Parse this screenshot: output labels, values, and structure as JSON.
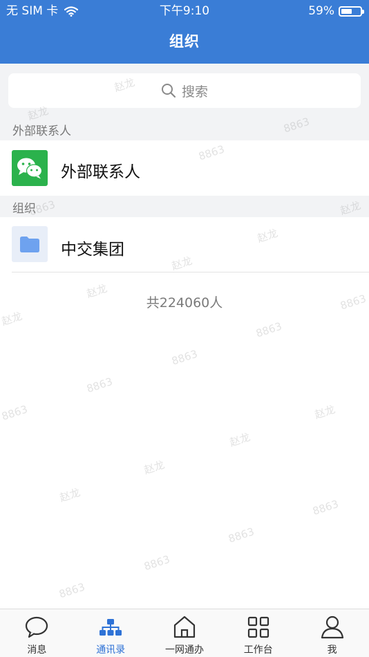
{
  "status_bar": {
    "carrier": "无 SIM 卡",
    "time": "下午9:10",
    "battery_text": "59%",
    "battery_level": 0.59
  },
  "nav": {
    "title": "组织"
  },
  "search": {
    "placeholder": "搜索"
  },
  "sections": {
    "external_header": "外部联系人",
    "org_header": "组织"
  },
  "rows": {
    "external": {
      "label": "外部联系人",
      "icon": "wechat-icon",
      "icon_color": "#2bb24c"
    },
    "org": {
      "label": "中交集团",
      "icon": "folder-icon",
      "icon_color": "#6ea2ef"
    }
  },
  "total_text": "共224060人",
  "tabbar": {
    "active_color": "#2e72d6",
    "items": [
      {
        "label": "消息",
        "icon": "chat-bubble-icon"
      },
      {
        "label": "通讯录",
        "icon": "org-chart-icon",
        "active": true
      },
      {
        "label": "一网通办",
        "icon": "home-icon"
      },
      {
        "label": "工作台",
        "icon": "grid-icon"
      },
      {
        "label": "我",
        "icon": "person-icon"
      }
    ]
  },
  "watermarks": [
    "赵龙",
    "8863"
  ]
}
